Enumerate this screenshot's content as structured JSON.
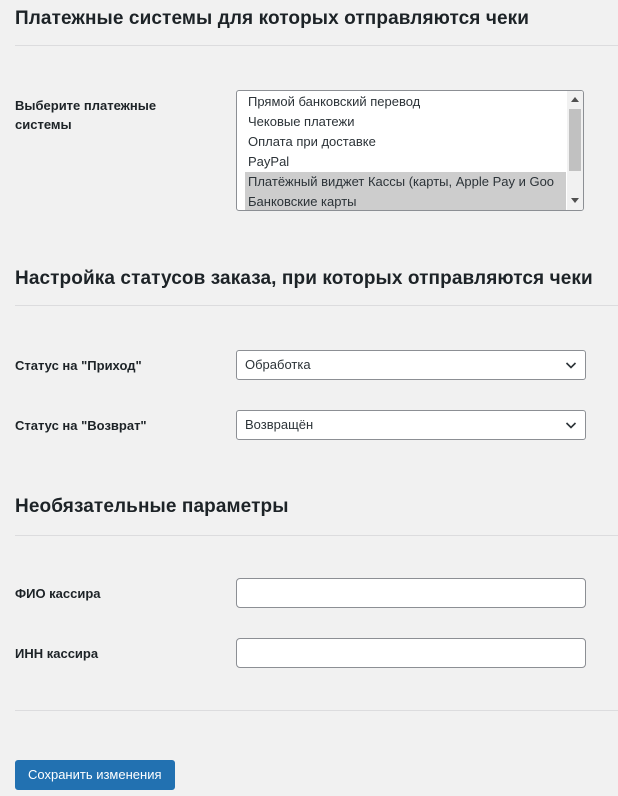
{
  "sections": {
    "payment": {
      "title": "Платежные системы для которых отправляются чеки",
      "label": "Выберите платежные системы",
      "options": [
        {
          "label": "Прямой банковский перевод",
          "selected": false
        },
        {
          "label": "Чековые платежи",
          "selected": false
        },
        {
          "label": "Оплата при доставке",
          "selected": false
        },
        {
          "label": "PayPal",
          "selected": false
        },
        {
          "label": "Платёжный виджет Кассы (карты, Apple Pay и Goo",
          "selected": true
        },
        {
          "label": "Банковские карты",
          "selected": true
        }
      ]
    },
    "statuses": {
      "title": "Настройка статусов заказа, при которых отправляются чеки",
      "income_label": "Статус на \"Приход\"",
      "income_value": "Обработка",
      "refund_label": "Статус на \"Возврат\"",
      "refund_value": "Возвращён"
    },
    "optional": {
      "title": "Необязательные параметры",
      "cashier_name_label": "ФИО кассира",
      "cashier_name_value": "",
      "cashier_inn_label": "ИНН кассира",
      "cashier_inn_value": ""
    }
  },
  "save_button": "Сохранить изменения",
  "colors": {
    "accent": "#2271b1",
    "background": "#f1f1f1",
    "selected_option": "#cdcdcd"
  }
}
